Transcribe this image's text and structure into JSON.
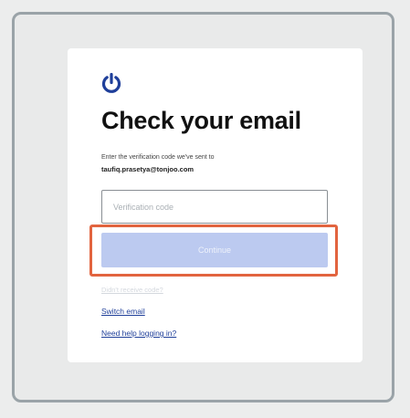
{
  "page": {
    "title": "Check your email",
    "subtitle": "Enter the verification code we've sent to",
    "email": "taufiq.prasetya@tonjoo.com"
  },
  "form": {
    "code_placeholder": "Verification code",
    "continue_label": "Continue"
  },
  "links": {
    "resend": "Didn't receive code?",
    "switch_email": "Switch email",
    "need_help": "Need help logging in?"
  },
  "colors": {
    "brand": "#1f3f9a",
    "button_disabled": "#bccaf0",
    "highlight": "#e2643f"
  },
  "icons": {
    "logo": "power-icon"
  }
}
